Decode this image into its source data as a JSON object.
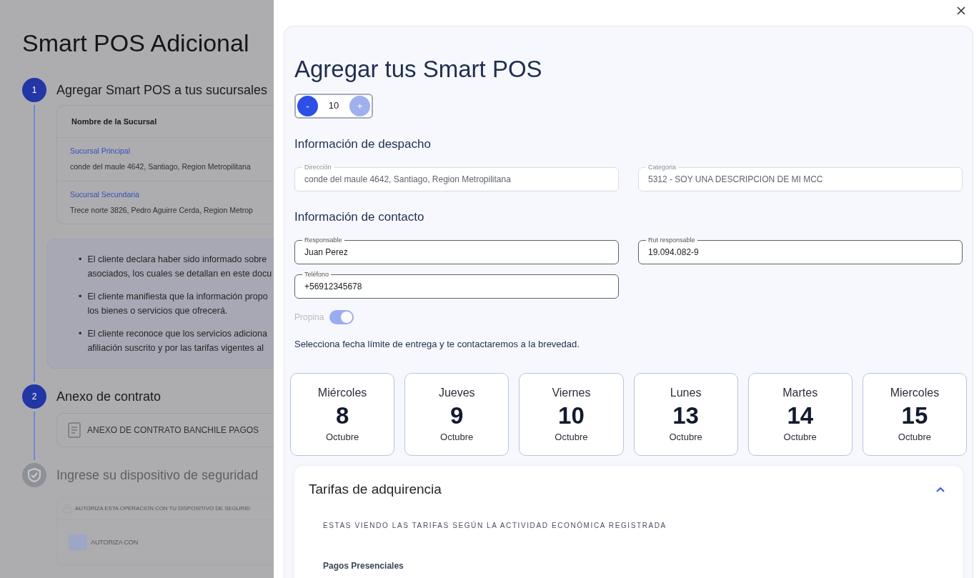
{
  "page": {
    "title": "Smart POS Adicional",
    "steps": [
      {
        "marker": "1",
        "title": "Agregar Smart POS a tus sucursales",
        "active": true
      },
      {
        "marker": "2",
        "title": "Anexo de contrato",
        "active": true
      },
      {
        "title": "Ingrese su dispositivo de seguridad",
        "active": false
      }
    ],
    "branches_table": {
      "header": "Nombre de la Sucursal",
      "rows": [
        {
          "name": "Sucursal Principal",
          "address": "conde del maule 4642, Santiago, Region Metropilitana"
        },
        {
          "name": "Sucursal Secundaria",
          "address": "Trece norte 3826, Pedro Aguirre Cerda, Region Metrop"
        }
      ]
    },
    "terms": [
      {
        "marker": "•",
        "text": "El cliente declara haber sido informado sobre\nasociados, los cuales se detallan en este docu"
      },
      {
        "marker": "•",
        "text": "El cliente manifiesta que la información propo\nlos bienes o servicios que ofrecerá."
      },
      {
        "marker": "•",
        "text": "El cliente reconoce que los servicios adiciona\nafiliación suscrito y por las tarifas vigentes al"
      }
    ],
    "annex": "ANEXO DE CONTRATO BANCHILE PAGOS",
    "security": {
      "notice": "AUTORIZA ESTA OPERACION CON TU DISPOSITIVO DE SEGURID",
      "method_label": "AUTORIZA CON"
    }
  },
  "drawer": {
    "title": "Agregar tus Smart POS",
    "counter": {
      "minus": "-",
      "value": "10",
      "plus": "+",
      "minus_disabled": false,
      "plus_disabled": true
    },
    "sections": [
      {
        "heading": "Información de despacho",
        "fields": [
          {
            "label": "Dirección",
            "value": "conde del maule 4642, Santiago, Region Metropilitana",
            "disabled": true
          },
          {
            "label": "Categoria",
            "value": "5312 - SOY UNA DESCRIPCION DE MI MCC",
            "disabled": true
          }
        ]
      },
      {
        "heading": "Información de contacto",
        "fields": [
          {
            "label": "Responsable",
            "value": "Juan Perez",
            "disabled": false
          },
          {
            "label": "Rut responsable",
            "value": "19.094.082-9",
            "disabled": false
          },
          {
            "label": "Teléfono",
            "value": "+56912345678",
            "disabled": false
          }
        ]
      }
    ],
    "tip_toggle": {
      "label": "Propina",
      "on": true,
      "disabled": true
    },
    "date_prompt": "Selecciona fecha límite de entrega y te contactaremos a la brevedad.",
    "dates": [
      {
        "weekday": "Miércoles",
        "day": "8",
        "month": "Octubre"
      },
      {
        "weekday": "Jueves",
        "day": "9",
        "month": "Octubre"
      },
      {
        "weekday": "Viernes",
        "day": "10",
        "month": "Octubre"
      },
      {
        "weekday": "Lunes",
        "day": "13",
        "month": "Octubre"
      },
      {
        "weekday": "Martes",
        "day": "14",
        "month": "Octubre"
      },
      {
        "weekday": "Miercoles",
        "day": "15",
        "month": "Octubre"
      }
    ],
    "rates": {
      "title": "Tarifas de adquirencia",
      "expanded": true,
      "note": "ESTAS VIENDO LAS TARIFAS SEGÚN LA ACTIVIDAD ECONÓMICA REGISTRADA",
      "subheading": "Pagos Presenciales"
    }
  }
}
